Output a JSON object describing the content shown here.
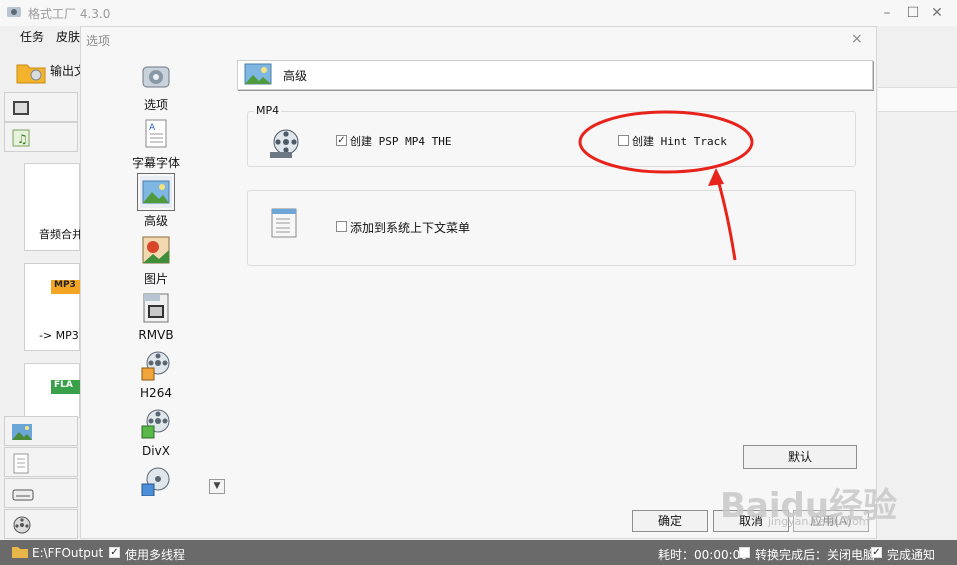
{
  "app": {
    "title": "格式工厂 4.3.0"
  },
  "menu": {
    "items": [
      "任务",
      "皮肤"
    ]
  },
  "toolbar": {
    "output_folder_label": "输出文"
  },
  "tiles": [
    {
      "label": "音频合并",
      "badge": ""
    },
    {
      "label": "-> MP3",
      "badge": "MP3"
    },
    {
      "label": "",
      "badge": "FLA"
    }
  ],
  "dialog": {
    "title": "选项",
    "close": "×",
    "nav": [
      {
        "label": "选项",
        "icon": "options-icon"
      },
      {
        "label": "字幕字体",
        "icon": "subtitle-font-icon"
      },
      {
        "label": "高级",
        "icon": "advanced-icon",
        "selected": true
      },
      {
        "label": "图片",
        "icon": "picture-icon"
      },
      {
        "label": "RMVB",
        "icon": "rmvb-icon"
      },
      {
        "label": "H264",
        "icon": "h264-icon"
      },
      {
        "label": "DivX",
        "icon": "divx-icon"
      }
    ],
    "nav_scroll": "▼",
    "panel_title": "高级",
    "mp4_group_label": "MP4",
    "checkbox_psp": {
      "label": "创建 PSP MP4 THE",
      "checked": true
    },
    "checkbox_hint": {
      "label": "创建 Hint Track",
      "checked": false
    },
    "checkbox_context": {
      "label": "添加到系统上下文菜单",
      "checked": false
    },
    "buttons": {
      "default": "默认",
      "ok": "确定",
      "cancel": "取消",
      "apply": "应用(A)"
    }
  },
  "status": {
    "output_path": "E:\\FFOutput",
    "multithread": {
      "label": "使用多线程",
      "checked": true
    },
    "elapsed": "耗时：00:00:00",
    "shutdown": {
      "label": "转换完成后：关闭电脑",
      "checked": false
    },
    "notify": {
      "label": "完成通知",
      "checked": true
    }
  },
  "watermark": {
    "text": "Baidu经验",
    "sub": "jingyan.baidu.com"
  },
  "colors": {
    "annotation": "#e8231c",
    "statusbar": "#6a6a6a"
  }
}
